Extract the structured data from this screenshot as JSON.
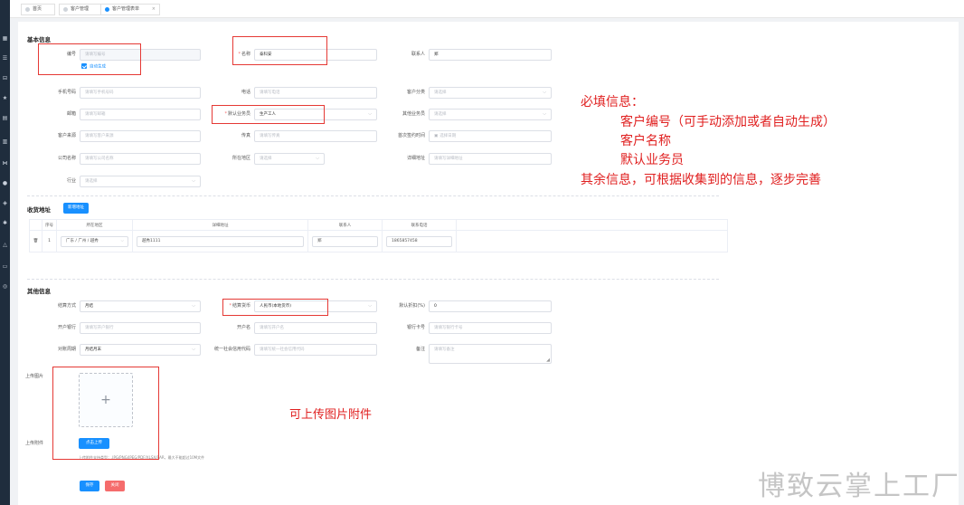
{
  "sidebar_icons": [
    "grid-icon",
    "list-icon",
    "cart-icon",
    "star-icon",
    "table-icon",
    "chart-icon",
    "users-icon",
    "gear-icon",
    "coin-icon",
    "settings-icon",
    "triangle-icon",
    "doc-icon",
    "clock-icon"
  ],
  "tabs": [
    {
      "label": "首页"
    },
    {
      "label": "客户管理"
    },
    {
      "label": "客户管理表单",
      "close": "×"
    }
  ],
  "basic": {
    "title": "基本信息",
    "code": {
      "label": "编号",
      "placeholder": "请填写编号"
    },
    "auto_gen": {
      "label": "自动生成"
    },
    "name": {
      "label": "名称",
      "value": "泰科安"
    },
    "contact": {
      "label": "联系人",
      "value": "郑"
    },
    "mobile": {
      "label": "手机号码",
      "placeholder": "请填写手机号码"
    },
    "phone": {
      "label": "电话",
      "placeholder": "请填写电话"
    },
    "grade": {
      "label": "客户分类",
      "placeholder": "请选择"
    },
    "email": {
      "label": "邮箱",
      "placeholder": "请填写邮箱"
    },
    "salesman": {
      "label": "默认业务员",
      "value": "生产工人"
    },
    "other_sales": {
      "label": "其他业务员",
      "placeholder": "请选择"
    },
    "source": {
      "label": "客户来源",
      "placeholder": "请填写客户来源"
    },
    "fax": {
      "label": "传真",
      "placeholder": "请填写传真"
    },
    "first_sign": {
      "label": "首次签约时间",
      "placeholder": "选择日期"
    },
    "company": {
      "label": "公司名称",
      "placeholder": "请填写公司名称"
    },
    "region": {
      "label": "所在地区",
      "placeholder": "请选择"
    },
    "address": {
      "label": "详细地址",
      "placeholder": "请填写详细地址"
    },
    "industry": {
      "label": "行业",
      "placeholder": "请选择"
    }
  },
  "shipping": {
    "title": "收货地址",
    "add_button": "新增地址",
    "headers": [
      "序号",
      "所在地区",
      "详细地址",
      "联系人",
      "联系电话"
    ],
    "rows": [
      {
        "index": "1",
        "region": "广东 / 广州 / 越秀",
        "address": "越秀1111",
        "contact": "郑",
        "phone": "1865857458"
      }
    ]
  },
  "other": {
    "title": "其他信息",
    "settle": {
      "label": "结算方式",
      "value": "月结"
    },
    "currency": {
      "label": "结算货币",
      "value": "人民币(本地货币)"
    },
    "discount": {
      "label": "默认折扣(%)",
      "value": "0"
    },
    "bank": {
      "label": "开户银行",
      "placeholder": "请填写开户银行"
    },
    "account_name": {
      "label": "开户名",
      "placeholder": "请填写开户名"
    },
    "bank_no": {
      "label": "银行卡号",
      "placeholder": "请填写银行卡号"
    },
    "period": {
      "label": "对账周期",
      "value": "月结月末"
    },
    "credit_code": {
      "label": "统一社会信用代码",
      "placeholder": "请填写统一社会信用代码"
    },
    "remark": {
      "label": "备注",
      "placeholder": "请填写备注"
    },
    "upload_image": {
      "label": "上传图片",
      "plus": "+"
    },
    "upload_file": {
      "label": "上传附件",
      "button": "点击上传"
    },
    "upload_tip": "上传附件支持类型：.JPG/PNG/JPEG/PDF/XLSX/RAR，最大不能超过10M文件"
  },
  "actions": {
    "save": "保存",
    "close": "关闭"
  },
  "annotations": {
    "required_title": "必填信息：",
    "required_1": "客户编号（可手动添加或者自动生成）",
    "required_2": "客户名称",
    "required_3": "默认业务员",
    "others": "其余信息，可根据收集到的信息，逐步完善",
    "upload_note": "可上传图片附件"
  },
  "watermark": "博致云掌上工厂",
  "colors": {
    "primary": "#1890ff",
    "danger": "#f56c6c",
    "annotation": "#e02020",
    "sidebar": "#1f2d3d"
  }
}
